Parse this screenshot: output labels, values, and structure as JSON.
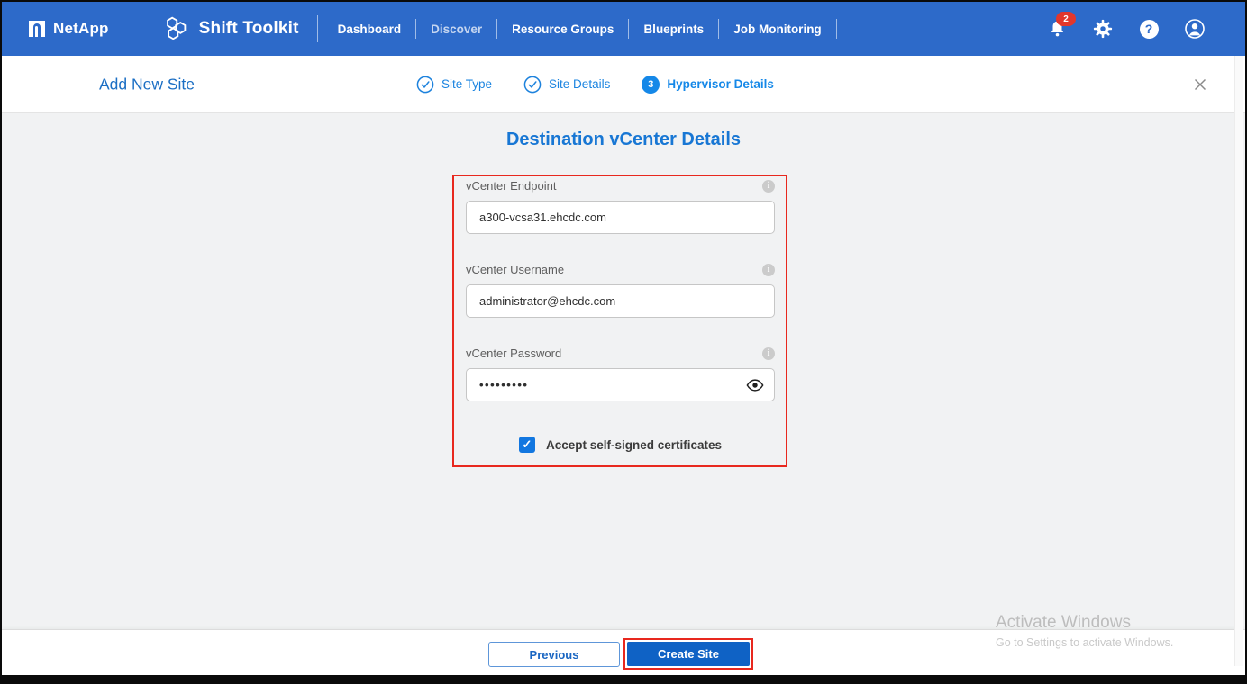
{
  "navbar": {
    "brand": "NetApp",
    "app_title": "Shift Toolkit",
    "items": [
      {
        "label": "Dashboard"
      },
      {
        "label": "Discover"
      },
      {
        "label": "Resource Groups"
      },
      {
        "label": "Blueprints"
      },
      {
        "label": "Job Monitoring"
      }
    ],
    "notifications": {
      "badge": "2"
    }
  },
  "wizard": {
    "title": "Add New Site",
    "steps": [
      {
        "label": "Site Type",
        "state": "complete"
      },
      {
        "label": "Site Details",
        "state": "complete"
      },
      {
        "number": "3",
        "label": "Hypervisor Details",
        "state": "active"
      }
    ]
  },
  "content": {
    "heading": "Destination vCenter Details",
    "fields": [
      {
        "label": "vCenter Endpoint",
        "value": "a300-vcsa31.ehcdc.com",
        "masked": false
      },
      {
        "label": "vCenter Username",
        "value": "administrator@ehcdc.com",
        "masked": false
      },
      {
        "label": "vCenter Password",
        "value": "•••••••••",
        "masked": true
      }
    ],
    "checkbox": {
      "label": "Accept self-signed certificates",
      "checked": true
    }
  },
  "footer": {
    "previous_label": "Previous",
    "create_label": "Create Site"
  },
  "watermark": {
    "line1": "Activate Windows",
    "line2": "Go to Settings to activate Windows."
  },
  "colors": {
    "navbar_blue": "#2d6ac9",
    "accent_blue": "#1877d4",
    "active_step_blue": "#1588e8",
    "button_blue": "#0f62c5",
    "annotation_red": "#e8281e",
    "badge_red": "#e2372c",
    "checkbox_blue": "#1277e0"
  }
}
